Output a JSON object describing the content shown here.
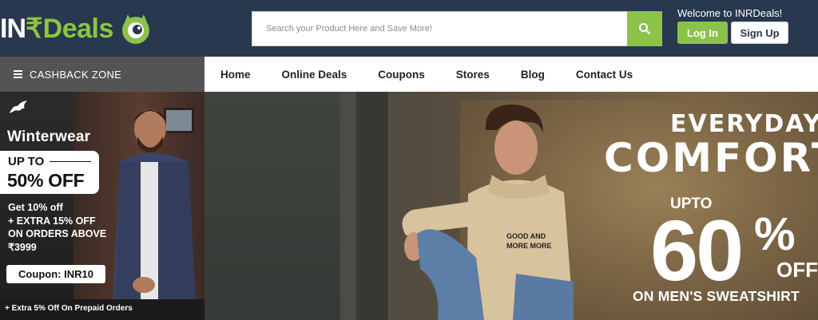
{
  "header": {
    "logo_in": "IN",
    "logo_rupee": "₹",
    "logo_deals": "Deals",
    "search_placeholder": "Search your Product Here and Save More!",
    "welcome": "Welcome to INRDeals!",
    "login_label": "Log In",
    "signup_label": "Sign Up"
  },
  "nav": {
    "cashback_label": "CASHBACK ZONE",
    "items": [
      "Home",
      "Online Deals",
      "Coupons",
      "Stores",
      "Blog",
      "Contact Us"
    ]
  },
  "promo_left": {
    "title": "Winterwear",
    "upto": "UP TO",
    "discount": "50% OFF",
    "offer_line1": "Get 10% off",
    "offer_line2": "+ EXTRA 15% OFF",
    "offer_line3": "ON ORDERS ABOVE",
    "offer_line4": "₹3999",
    "coupon": "Coupon: INR10",
    "prepaid": "+ Extra 5% Off On Prepaid Orders"
  },
  "hero": {
    "line1": "EVERYDAY",
    "line2": "COMFORT",
    "upto": "UPTO",
    "percent": "60",
    "percent_sign": "%",
    "off": "OFF",
    "tagline": "ON MEN'S SWEATSHIRT",
    "hoodie_print": "GOOD AND MORE MORE"
  },
  "colors": {
    "header_bg": "#27384f",
    "accent_green": "#8bc34a",
    "cashback_bg": "#545454"
  }
}
